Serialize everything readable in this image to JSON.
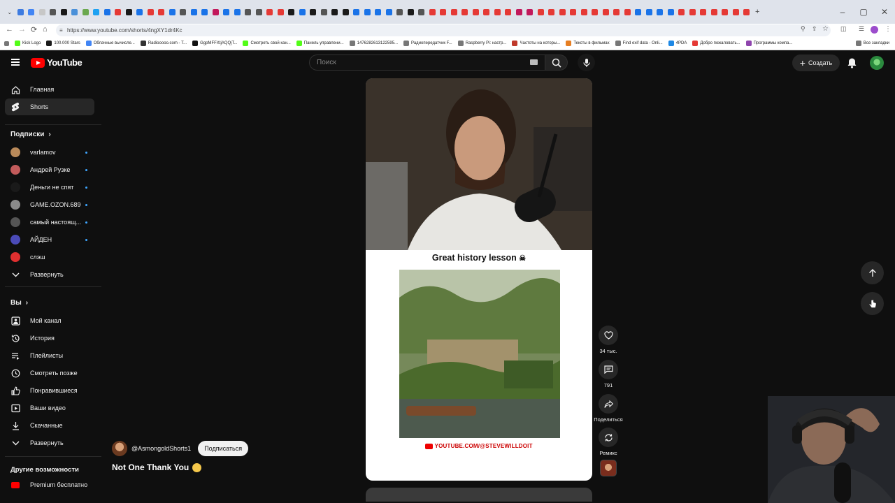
{
  "browser": {
    "url": "https://www.youtube.com/shorts/4ngXY1dr4Kc",
    "tab_colors": [
      "#3d7be0",
      "#4285f4",
      "#c7c7c7",
      "#555",
      "#1a1a1a",
      "#4a90d9",
      "#6aa84f",
      "#1da1f2",
      "#1a73e8",
      "#e53935",
      "#1a1a1a",
      "#1a73e8",
      "#e53935",
      "#e53935",
      "#1a73e8",
      "#555",
      "#1a73e8",
      "#1a73e8",
      "#c2185b",
      "#1a73e8",
      "#1a73e8",
      "#555",
      "#555",
      "#e53935",
      "#e53935",
      "#1a1a1a",
      "#1a73e8",
      "#1a1a1a",
      "#555",
      "#1a1a1a",
      "#1a1a1a",
      "#1a73e8",
      "#1a73e8",
      "#1a73e8",
      "#1a73e8",
      "#555",
      "#1a1a1a",
      "#555",
      "#e53935",
      "#e53935",
      "#e53935",
      "#e53935",
      "#e53935",
      "#e53935",
      "#e53935",
      "#e53935",
      "#c2185b",
      "#c2185b",
      "#e53935",
      "#e53935",
      "#e53935",
      "#e53935",
      "#e53935",
      "#e53935",
      "#e53935",
      "#e53935",
      "#e53935",
      "#1a73e8",
      "#1a73e8",
      "#1a73e8",
      "#1a73e8",
      "#e53935",
      "#e53935",
      "#e53935",
      "#e53935",
      "#e53935",
      "#e53935",
      "#e53935"
    ],
    "active_tab_index": 69,
    "bookmarks": [
      {
        "label": "Kick Logo",
        "color": "#53fc18"
      },
      {
        "label": "100.000 Stars",
        "color": "#1a1a1a"
      },
      {
        "label": "Облачные вычисле...",
        "color": "#4285f4"
      },
      {
        "label": "Radiooooo.com - T...",
        "color": "#333"
      },
      {
        "label": "GgpMFFXtjAQQjT...",
        "color": "#111"
      },
      {
        "label": "Смотреть свой кан...",
        "color": "#53fc18"
      },
      {
        "label": "Панель управлени...",
        "color": "#53fc18"
      },
      {
        "label": "1476282613122595...",
        "color": "#777"
      },
      {
        "label": "Радиопередатчик F...",
        "color": "#777"
      },
      {
        "label": "Raspberry Pi: настр...",
        "color": "#777"
      },
      {
        "label": "Частоты на которы...",
        "color": "#c0392b"
      },
      {
        "label": "Тексты в фильмах",
        "color": "#e67e22"
      },
      {
        "label": "Find exif data - Onli...",
        "color": "#777"
      },
      {
        "label": "4PDA",
        "color": "#1e88e5"
      },
      {
        "label": "Добро пожаловать...",
        "color": "#e53935"
      },
      {
        "label": "Программы компа...",
        "color": "#8e44ad"
      }
    ],
    "all_bookmarks": "Все закладки"
  },
  "masthead": {
    "logo_text": "YouTube",
    "search_placeholder": "Поиск",
    "create_label": "Создать"
  },
  "sidebar": {
    "main": [
      {
        "label": "Главная",
        "icon": "home-icon",
        "active": false
      },
      {
        "label": "Shorts",
        "icon": "shorts-icon",
        "active": true
      }
    ],
    "subs_heading": "Подписки",
    "subscriptions": [
      {
        "label": "varlamov",
        "color": "#b98a5a"
      },
      {
        "label": "Андрей Рузке",
        "color": "#c25b5b"
      },
      {
        "label": "Деньги не спят",
        "color": "#1a1a1a"
      },
      {
        "label": "GAME.OZON.689",
        "color": "#8a8a8a"
      },
      {
        "label": "самый настоящ...",
        "color": "#555"
      },
      {
        "label": "АЙДЕН",
        "color": "#4b4bb8"
      },
      {
        "label": "слэш",
        "color": "#e03030"
      }
    ],
    "subs_expand": "Развернуть",
    "you_heading": "Вы",
    "you_items": [
      {
        "label": "Мой канал",
        "icon": "channel-icon"
      },
      {
        "label": "История",
        "icon": "history-icon"
      },
      {
        "label": "Плейлисты",
        "icon": "playlists-icon"
      },
      {
        "label": "Смотреть позже",
        "icon": "watch-later-icon"
      },
      {
        "label": "Понравившиеся",
        "icon": "like-icon"
      },
      {
        "label": "Ваши видео",
        "icon": "your-videos-icon"
      },
      {
        "label": "Скачанные",
        "icon": "download-icon"
      }
    ],
    "you_expand": "Развернуть",
    "more_heading": "Другие возможности",
    "premium_label": "Premium бесплатно"
  },
  "short": {
    "caption": "Great history lesson",
    "watermark": "YOUTUBE.COM/@STEVEWILLDOIT",
    "channel": "@AsmongoldShorts1",
    "subscribe_label": "Подписаться",
    "title": "Not One Thank You"
  },
  "actions": {
    "likes": "34 тыс.",
    "comments": "791",
    "share": "Поделиться",
    "remix": "Ремикс"
  }
}
